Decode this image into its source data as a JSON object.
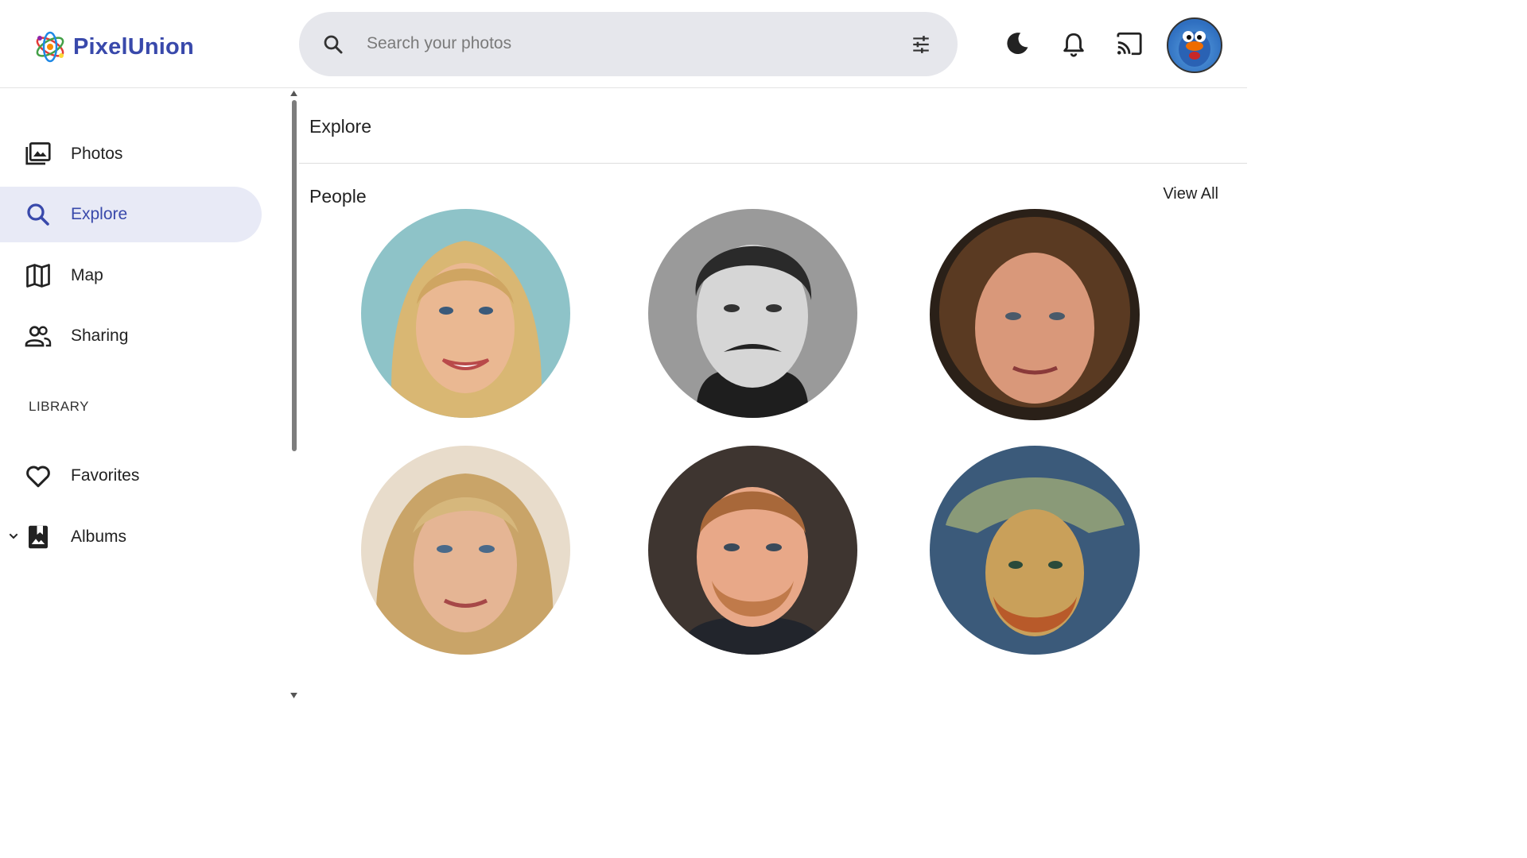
{
  "app": {
    "name": "PixelUnion"
  },
  "search": {
    "placeholder": "Search your photos"
  },
  "icons": {
    "search": "search-icon",
    "tune": "tune-icon",
    "theme": "moon-icon",
    "notifications": "bell-icon",
    "cast": "cast-icon"
  },
  "sidebar": {
    "items": [
      {
        "label": "Photos",
        "icon": "photos-icon",
        "active": false
      },
      {
        "label": "Explore",
        "icon": "search-icon",
        "active": true
      },
      {
        "label": "Map",
        "icon": "map-icon",
        "active": false
      },
      {
        "label": "Sharing",
        "icon": "people-icon",
        "active": false
      }
    ],
    "library_label": "LIBRARY",
    "library_items": [
      {
        "label": "Favorites",
        "icon": "heart-icon"
      },
      {
        "label": "Albums",
        "icon": "album-icon"
      }
    ]
  },
  "main": {
    "title": "Explore",
    "people_section": {
      "title": "People",
      "view_all": "View All"
    }
  },
  "colors": {
    "accent": "#3949ab",
    "active_bg": "#e8eaf6",
    "search_bg": "#e6e7ec"
  }
}
